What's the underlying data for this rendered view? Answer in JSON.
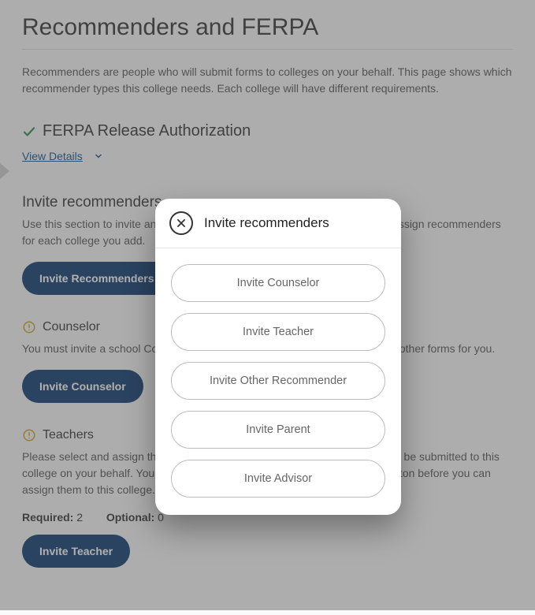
{
  "page": {
    "title": "Recommenders and FERPA",
    "intro": "Recommenders are people who will submit forms to colleges on your behalf. This page shows which recommender types this college needs. Each college will have different requirements."
  },
  "ferpa": {
    "title": "FERPA Release Authorization",
    "view_details": "View Details"
  },
  "invite_section": {
    "title": "Invite recommenders",
    "desc": "Use this section to invite and manage your recommenders. You will need to assign recommenders for each college you add.",
    "button": "Invite Recommenders"
  },
  "counselor": {
    "title": "Counselor",
    "desc": "You must invite a school Counselor who will complete the School Report and other forms for you.",
    "button": "Invite Counselor"
  },
  "teachers": {
    "title": "Teachers",
    "desc": "Please select and assign the Teacher(s) below whose recommendation(s) will be submitted to this college on your behalf. You must invite a Teacher using the Invite Teacher button before you can assign them to this college.",
    "required_label": "Required:",
    "required_value": "2",
    "optional_label": "Optional:",
    "optional_value": "0",
    "button": "Invite Teacher"
  },
  "modal": {
    "title": "Invite recommenders",
    "options": {
      "counselor": "Invite Counselor",
      "teacher": "Invite Teacher",
      "other": "Invite Other Recommender",
      "parent": "Invite Parent",
      "advisor": "Invite Advisor"
    }
  }
}
